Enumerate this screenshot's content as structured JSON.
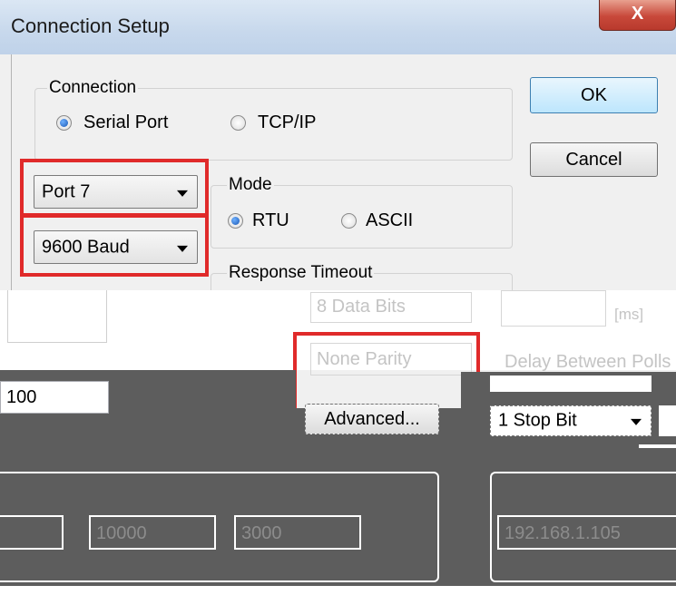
{
  "window": {
    "title": "Connection Setup",
    "close_label": "X"
  },
  "connection": {
    "legend": "Connection",
    "serial_port": "Serial Port",
    "tcp_ip": "TCP/IP",
    "selected": "Serial Port"
  },
  "buttons": {
    "ok": "OK",
    "cancel": "Cancel",
    "advanced": "Advanced..."
  },
  "port_combo": {
    "value": "Port 7"
  },
  "baud_combo": {
    "value": "9600 Baud"
  },
  "mode": {
    "legend": "Mode",
    "rtu": "RTU",
    "ascii": "ASCII",
    "selected": "RTU"
  },
  "response_timeout": {
    "legend": "Response Timeout",
    "unit": "[ms]"
  },
  "data_bits_combo": {
    "value": "8 Data Bits"
  },
  "parity_combo": {
    "value": "None Parity"
  },
  "delay_between_polls": {
    "legend": "Delay Between Polls"
  },
  "stop_bit_combo": {
    "value": "1 Stop Bit"
  },
  "fields": {
    "value_100": "100",
    "value_10000": "10000",
    "value_3000": "3000",
    "ip_address": "192.168.1.105"
  },
  "colors": {
    "highlight": "#e02a2a",
    "default_button": "#bde6fd"
  }
}
